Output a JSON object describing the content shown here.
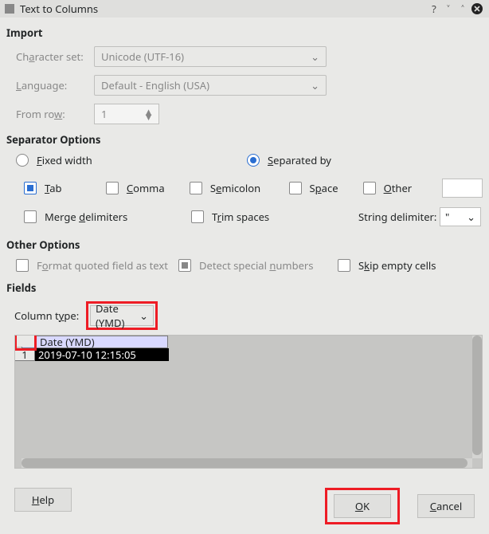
{
  "window": {
    "title": "Text to Columns"
  },
  "sections": {
    "import": "Import",
    "separator": "Separator Options",
    "other": "Other Options",
    "fields": "Fields"
  },
  "import": {
    "charset_label_pre": "Ch",
    "charset_label_u": "a",
    "charset_label_post": "racter set:",
    "charset_value": "Unicode (UTF-16)",
    "language_label_u": "L",
    "language_label_post": "anguage:",
    "language_value": "Default - English (USA)",
    "fromrow_label_pre": "From ro",
    "fromrow_label_u": "w",
    "fromrow_label_post": ":",
    "fromrow_value": "1"
  },
  "separator": {
    "fixed_u": "F",
    "fixed_post": "ixed width",
    "separated_u": "S",
    "separated_post": "eparated by",
    "tab_u": "T",
    "tab_post": "ab",
    "comma_u": "C",
    "comma_post": "omma",
    "semicolon_pre": "S",
    "semicolon_u": "e",
    "semicolon_post": "micolon",
    "space_pre": "S",
    "space_u": "p",
    "space_post": "ace",
    "other_u": "O",
    "other_post": "ther",
    "merge_pre": "Merge ",
    "merge_u": "d",
    "merge_post": "elimiters",
    "trim_pre": "T",
    "trim_u": "r",
    "trim_post": "im spaces",
    "string_delim_label": "String delimiter:",
    "string_delim_value": "\""
  },
  "other": {
    "format_pre": "F",
    "format_u": "o",
    "format_post": "rmat quoted field as text",
    "detect_pre": "Detect special ",
    "detect_u": "n",
    "detect_post": "umbers",
    "skip_pre": "S",
    "skip_u": "k",
    "skip_post": "ip empty cells"
  },
  "fields": {
    "columntype_pre": "Column t",
    "columntype_u": "y",
    "columntype_post": "pe:",
    "columntype_value": "Date (YMD)",
    "preview_header": "Date (YMD)",
    "preview_rownum": "1",
    "preview_data": "2019-07-10 12:15:05"
  },
  "buttons": {
    "help_u": "H",
    "help_post": "elp",
    "ok_u": "O",
    "ok_post": "K",
    "cancel_u": "C",
    "cancel_post": "ancel"
  }
}
